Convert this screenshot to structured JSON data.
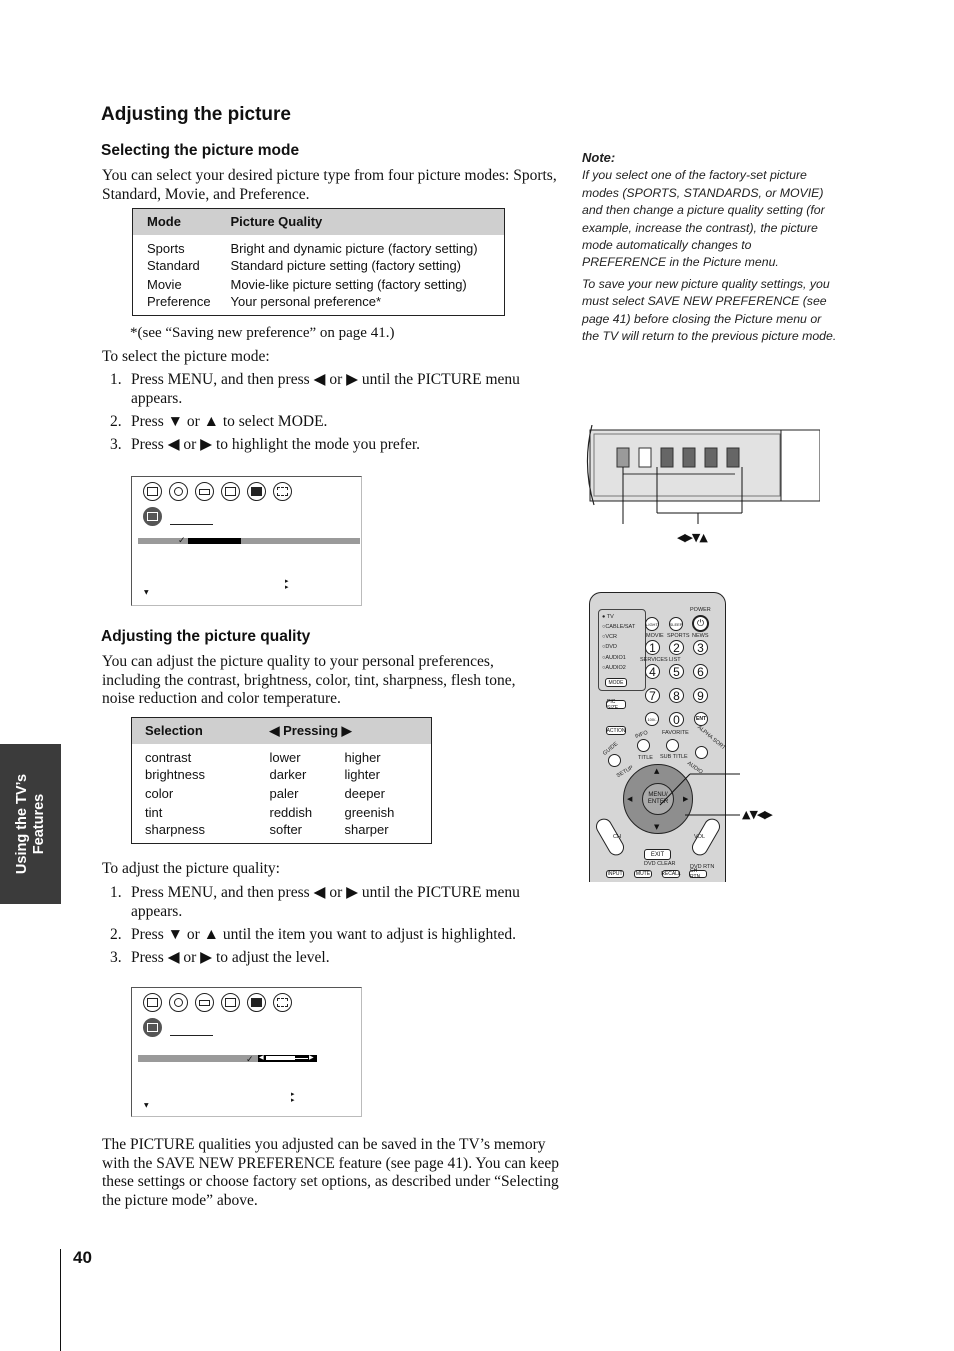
{
  "page": {
    "title": "Adjusting the picture",
    "page_number": "40",
    "side_tab": [
      "Using the TV’s",
      "Features"
    ]
  },
  "section_mode": {
    "heading": "Selecting the picture mode",
    "intro": "You can select your desired picture type from four picture modes: Sports, Standard, Movie, and Preference.",
    "table": {
      "headers": [
        "Mode",
        "Picture Quality"
      ],
      "rows": [
        [
          "Sports",
          "Bright and dynamic picture (factory setting)"
        ],
        [
          "Standard",
          "Standard picture setting (factory setting)"
        ],
        [
          "Movie",
          "Movie-like picture setting (factory setting)"
        ],
        [
          "Preference",
          "Your personal preference*"
        ]
      ]
    },
    "footnote": "*(see “Saving new preference” on page 41.)",
    "lead": "To select the picture mode:",
    "steps": [
      {
        "num": "1.",
        "text": "Press MENU, and then press ◀ or ▶ until the PICTURE menu appears."
      },
      {
        "num": "2.",
        "text": "Press ▼ or ▲ to select MODE."
      },
      {
        "num": "3.",
        "text": "Press ◀ or ▶ to highlight the mode you prefer."
      }
    ]
  },
  "section_quality": {
    "heading": "Adjusting the picture quality",
    "intro": "You can adjust the picture quality to your personal preferences, including the contrast, brightness, color, tint, sharpness, flesh tone, noise reduction and color temperature.",
    "table": {
      "headers": [
        "Selection",
        "◀  Pressing  ▶"
      ],
      "rows": [
        [
          "contrast",
          "lower",
          "higher"
        ],
        [
          "brightness",
          "darker",
          "lighter"
        ],
        [
          "color",
          "paler",
          "deeper"
        ],
        [
          "tint",
          "reddish",
          "greenish"
        ],
        [
          "sharpness",
          "softer",
          "sharper"
        ]
      ]
    },
    "lead": "To adjust the picture quality:",
    "steps": [
      {
        "num": "1.",
        "text": "Press MENU, and then press ◀ or ▶ until the PICTURE menu appears."
      },
      {
        "num": "2.",
        "text": "Press ▼ or ▲ until the item you want to adjust is highlighted."
      },
      {
        "num": "3.",
        "text": "Press ◀ or ▶ to adjust the level."
      }
    ],
    "closing": "The PICTURE qualities you adjusted can be saved in the TV’s memory with the SAVE NEW PREFERENCE feature (see page 41). You can keep these settings or choose factory set options, as described under “Selecting the picture mode” above."
  },
  "note": {
    "title": "Note:",
    "paragraphs": [
      "If you select one of the factory-set picture modes (SPORTS, STANDARDS, or MOVIE) and then change a picture quality setting (for example, increase the contrast), the picture mode automatically changes to PREFERENCE in the Picture menu.",
      "To save your new picture quality settings, you must select SAVE NEW PREFERENCE (see page 41) before closing the Picture menu or the TV will return to the previous picture mode."
    ]
  },
  "tv_panel": {
    "arrows_label": "◀▶▼▲"
  },
  "remote": {
    "arrows_label": "▲▼◀▶",
    "modes": [
      "TV",
      "CABLE/SAT",
      "VCR",
      "DVD",
      "AUDIO1",
      "AUDIO2"
    ],
    "mode_button": "MODE",
    "top_buttons": [
      "LIGHT",
      "SLEEP"
    ],
    "power": "POWER",
    "number_labels": [
      "MOVIE",
      "SPORTS",
      "NEWS",
      "SERVICES",
      "LIST"
    ],
    "numbers": [
      "1",
      "2",
      "3",
      "4",
      "5",
      "6",
      "7",
      "8",
      "9",
      "100/-",
      "0",
      "ENT"
    ],
    "pic_size": "PIC SIZE",
    "action": "ACTION",
    "info": "INFO",
    "favorite": "FAVORITE",
    "alpha_sort": "ALPHA SORT",
    "guide": "GUIDE",
    "setup": "SETUP",
    "title": "TITLE",
    "sub_title": "SUB TITLE",
    "audio": "AUDIO",
    "menu_enter": "MENU/ ENTER",
    "ch": "CH",
    "vol": "VOL",
    "exit": "EXIT",
    "dvd_clear": "DVD CLEAR",
    "bottom_buttons": [
      "INPUT",
      "MUTE",
      "RECALL",
      "CH RTN"
    ],
    "dvd_rtn": "DVD RTN"
  },
  "osd": {
    "mode_level": 0.35,
    "quality_level": 0.68
  }
}
